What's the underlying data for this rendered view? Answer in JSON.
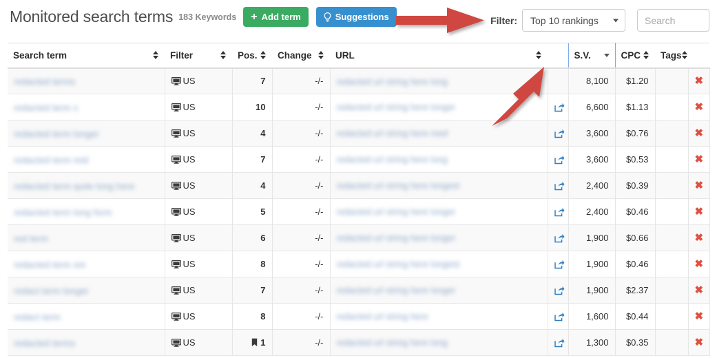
{
  "header": {
    "title": "Monitored search terms",
    "keyword_count": "183 Keywords",
    "add_term_label": "Add term",
    "add_term_glyph": "+",
    "suggestions_label": "Suggestions",
    "add_term_color": "#3cab62",
    "suggestions_color": "#3690d0"
  },
  "filter": {
    "label": "Filter:",
    "selected_option": "Top 10 rankings",
    "options": [
      "Top 10 rankings"
    ],
    "search_placeholder": "Search",
    "search_value": ""
  },
  "table": {
    "columns": [
      {
        "key": "term",
        "label": "Search term",
        "align": "left",
        "sortable": true
      },
      {
        "key": "filter",
        "label": "Filter",
        "align": "left",
        "sortable": true
      },
      {
        "key": "pos",
        "label": "Pos.",
        "align": "left",
        "sortable": true
      },
      {
        "key": "change",
        "label": "Change",
        "align": "left",
        "sortable": true
      },
      {
        "key": "url",
        "label": "URL",
        "align": "left",
        "sortable": true
      },
      {
        "key": "sv",
        "label": "S.V.",
        "align": "left",
        "sortable": true,
        "active_sort": "desc"
      },
      {
        "key": "cpc",
        "label": "CPC",
        "align": "left",
        "sortable": true
      },
      {
        "key": "tags",
        "label": "Tags",
        "align": "left",
        "sortable": true
      }
    ],
    "rows": [
      {
        "term": "redacted terms",
        "device": "monitor-icon",
        "country": "US",
        "pos": "7",
        "pos_icon": "",
        "change": "-/-",
        "url": "redacted url string here long",
        "share": false,
        "sv": "8,100",
        "cpc": "$1.20",
        "tags": "",
        "delete": "✖"
      },
      {
        "term": "redacted term x",
        "device": "monitor-icon",
        "country": "US",
        "pos": "10",
        "pos_icon": "",
        "change": "-/-",
        "url": "redacted url string here longer",
        "share": true,
        "sv": "6,600",
        "cpc": "$1.13",
        "tags": "",
        "delete": "✖"
      },
      {
        "term": "redacted term longer",
        "device": "monitor-icon",
        "country": "US",
        "pos": "4",
        "pos_icon": "",
        "change": "-/-",
        "url": "redacted url string here med",
        "share": true,
        "sv": "3,600",
        "cpc": "$0.76",
        "tags": "",
        "delete": "✖"
      },
      {
        "term": "redacted term mid",
        "device": "monitor-icon",
        "country": "US",
        "pos": "7",
        "pos_icon": "",
        "change": "-/-",
        "url": "redacted url string here long",
        "share": true,
        "sv": "3,600",
        "cpc": "$0.53",
        "tags": "",
        "delete": "✖"
      },
      {
        "term": "redacted term quite long here",
        "device": "monitor-icon",
        "country": "US",
        "pos": "4",
        "pos_icon": "",
        "change": "-/-",
        "url": "redacted url string here longest",
        "share": true,
        "sv": "2,400",
        "cpc": "$0.39",
        "tags": "",
        "delete": "✖"
      },
      {
        "term": "redacted term long form",
        "device": "monitor-icon",
        "country": "US",
        "pos": "5",
        "pos_icon": "",
        "change": "-/-",
        "url": "redacted url string here longer",
        "share": true,
        "sv": "2,400",
        "cpc": "$0.46",
        "tags": "",
        "delete": "✖"
      },
      {
        "term": "red term",
        "device": "monitor-icon",
        "country": "US",
        "pos": "6",
        "pos_icon": "",
        "change": "-/-",
        "url": "redacted url string here longer",
        "share": true,
        "sv": "1,900",
        "cpc": "$0.66",
        "tags": "",
        "delete": "✖"
      },
      {
        "term": "redacted term sm",
        "device": "monitor-icon",
        "country": "US",
        "pos": "8",
        "pos_icon": "",
        "change": "-/-",
        "url": "redacted url string here longest",
        "share": true,
        "sv": "1,900",
        "cpc": "$0.46",
        "tags": "",
        "delete": "✖"
      },
      {
        "term": "redact term longer",
        "device": "monitor-icon",
        "country": "US",
        "pos": "7",
        "pos_icon": "",
        "change": "-/-",
        "url": "redacted url string here longer",
        "share": true,
        "sv": "1,900",
        "cpc": "$2.37",
        "tags": "",
        "delete": "✖"
      },
      {
        "term": "redact term",
        "device": "monitor-icon",
        "country": "US",
        "pos": "8",
        "pos_icon": "",
        "change": "-/-",
        "url": "redacted url string here",
        "share": true,
        "sv": "1,600",
        "cpc": "$0.44",
        "tags": "",
        "delete": "✖"
      },
      {
        "term": "redacted terms",
        "device": "monitor-icon",
        "country": "US",
        "pos": "1",
        "pos_icon": "bookmark-icon",
        "change": "-/-",
        "url": "redacted url string here long",
        "share": true,
        "sv": "1,300",
        "cpc": "$0.35",
        "tags": "",
        "delete": "✖"
      }
    ]
  },
  "annotations": {
    "arrow_color": "#cf4741",
    "arrow_1_target": "Filter:",
    "arrow_2_target": "S.V."
  }
}
